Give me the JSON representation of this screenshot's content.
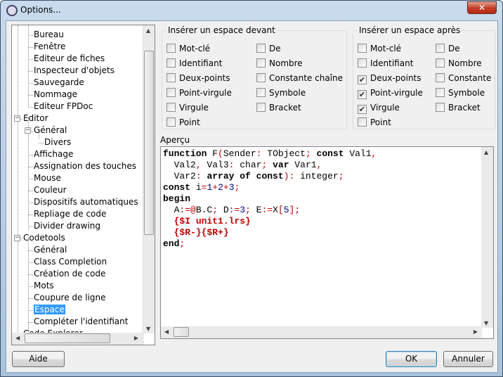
{
  "window": {
    "title": "Options...",
    "close_label": "✕"
  },
  "tree": {
    "items": [
      {
        "label": "Bureau",
        "level": 2
      },
      {
        "label": "Fenêtre",
        "level": 2
      },
      {
        "label": "Editeur de fiches",
        "level": 2
      },
      {
        "label": "Inspecteur d'objets",
        "level": 2
      },
      {
        "label": "Sauvegarde",
        "level": 2
      },
      {
        "label": "Nommage",
        "level": 2
      },
      {
        "label": "Editeur FPDoc",
        "level": 2
      },
      {
        "label": "Editor",
        "level": 1,
        "expanded": true
      },
      {
        "label": "Général",
        "level": 2,
        "expanded": true
      },
      {
        "label": "Divers",
        "level": 3
      },
      {
        "label": "Affichage",
        "level": 2
      },
      {
        "label": "Assignation des touches",
        "level": 2
      },
      {
        "label": "Mouse",
        "level": 2
      },
      {
        "label": "Couleur",
        "level": 2
      },
      {
        "label": "Dispositifs automatiques",
        "level": 2
      },
      {
        "label": "Repliage de code",
        "level": 2
      },
      {
        "label": "Divider drawing",
        "level": 2
      },
      {
        "label": "Codetools",
        "level": 1,
        "expanded": true
      },
      {
        "label": "Général",
        "level": 2
      },
      {
        "label": "Class Completion",
        "level": 2
      },
      {
        "label": "Création de code",
        "level": 2
      },
      {
        "label": "Mots",
        "level": 2
      },
      {
        "label": "Coupure de ligne",
        "level": 2
      },
      {
        "label": "Espace",
        "level": 2,
        "selected": true
      },
      {
        "label": "Compléter l'identifiant",
        "level": 2
      },
      {
        "label": "Code Explorer",
        "level": 1
      }
    ]
  },
  "before": {
    "title": "Insérer un espace devant",
    "options": [
      {
        "label": "Mot-clé",
        "checked": false
      },
      {
        "label": "Identifiant",
        "checked": false
      },
      {
        "label": "Deux-points",
        "checked": false
      },
      {
        "label": "Point-virgule",
        "checked": false
      },
      {
        "label": "Virgule",
        "checked": false
      },
      {
        "label": "Point",
        "checked": false
      },
      {
        "label": "De",
        "checked": false
      },
      {
        "label": "Nombre",
        "checked": false
      },
      {
        "label": "Constante chaîne",
        "checked": false
      },
      {
        "label": "Symbole",
        "checked": false
      },
      {
        "label": "Bracket",
        "checked": false
      }
    ]
  },
  "after": {
    "title": "Insérer un espace après",
    "options": [
      {
        "label": "Mot-clé",
        "checked": false
      },
      {
        "label": "Identifiant",
        "checked": false
      },
      {
        "label": "Deux-points",
        "checked": true
      },
      {
        "label": "Point-virgule",
        "checked": true
      },
      {
        "label": "Virgule",
        "checked": true
      },
      {
        "label": "Point",
        "checked": false
      },
      {
        "label": "De",
        "checked": false
      },
      {
        "label": "Nombre",
        "checked": false
      },
      {
        "label": "Constante chaîne",
        "checked": false
      },
      {
        "label": "Symbole",
        "checked": false
      },
      {
        "label": "Bracket",
        "checked": false
      }
    ]
  },
  "preview": {
    "title": "Aperçu",
    "lines": [
      [
        [
          "k",
          "function"
        ],
        [
          "t",
          " F"
        ],
        [
          "s",
          "("
        ],
        [
          "t",
          "Sender"
        ],
        [
          "s",
          ":"
        ],
        [
          "t",
          " TObject"
        ],
        [
          "s",
          ";"
        ],
        [
          "t",
          " "
        ],
        [
          "k",
          "const"
        ],
        [
          "t",
          " Val1"
        ],
        [
          "s",
          ","
        ]
      ],
      [
        [
          "t",
          "  Val2"
        ],
        [
          "s",
          ","
        ],
        [
          "t",
          " Val3"
        ],
        [
          "s",
          ":"
        ],
        [
          "t",
          " char"
        ],
        [
          "s",
          ";"
        ],
        [
          "t",
          " "
        ],
        [
          "k",
          "var"
        ],
        [
          "t",
          " Var1"
        ],
        [
          "s",
          ","
        ]
      ],
      [
        [
          "t",
          "  Var2"
        ],
        [
          "s",
          ":"
        ],
        [
          "t",
          " "
        ],
        [
          "k",
          "array of const"
        ],
        [
          "s",
          ")"
        ],
        [
          "s",
          ":"
        ],
        [
          "t",
          " integer"
        ],
        [
          "s",
          ";"
        ]
      ],
      [
        [
          "k",
          "const"
        ],
        [
          "t",
          " i"
        ],
        [
          "s",
          "="
        ],
        [
          "n",
          "1"
        ],
        [
          "s",
          "+"
        ],
        [
          "n",
          "2"
        ],
        [
          "s",
          "+"
        ],
        [
          "n",
          "3"
        ],
        [
          "s",
          ";"
        ]
      ],
      [
        [
          "k",
          "begin"
        ]
      ],
      [
        [
          "t",
          "  A"
        ],
        [
          "s",
          ":=@"
        ],
        [
          "t",
          "B.C"
        ],
        [
          "s",
          ";"
        ],
        [
          "t",
          " D"
        ],
        [
          "s",
          ":="
        ],
        [
          "n",
          "3"
        ],
        [
          "s",
          ";"
        ],
        [
          "t",
          " E"
        ],
        [
          "s",
          ":="
        ],
        [
          "t",
          "X"
        ],
        [
          "s",
          "["
        ],
        [
          "n",
          "5"
        ],
        [
          "s",
          "]"
        ],
        [
          "s",
          ";"
        ]
      ],
      [
        [
          "t",
          "  "
        ],
        [
          "d",
          "{$I unit1.lrs}"
        ]
      ],
      [
        [
          "t",
          "  "
        ],
        [
          "d",
          "{$R-}{$R+}"
        ]
      ],
      [
        [
          "k",
          "end"
        ],
        [
          "s",
          ";"
        ]
      ]
    ]
  },
  "buttons": {
    "help": "Aide",
    "ok": "OK",
    "cancel": "Annuler"
  }
}
